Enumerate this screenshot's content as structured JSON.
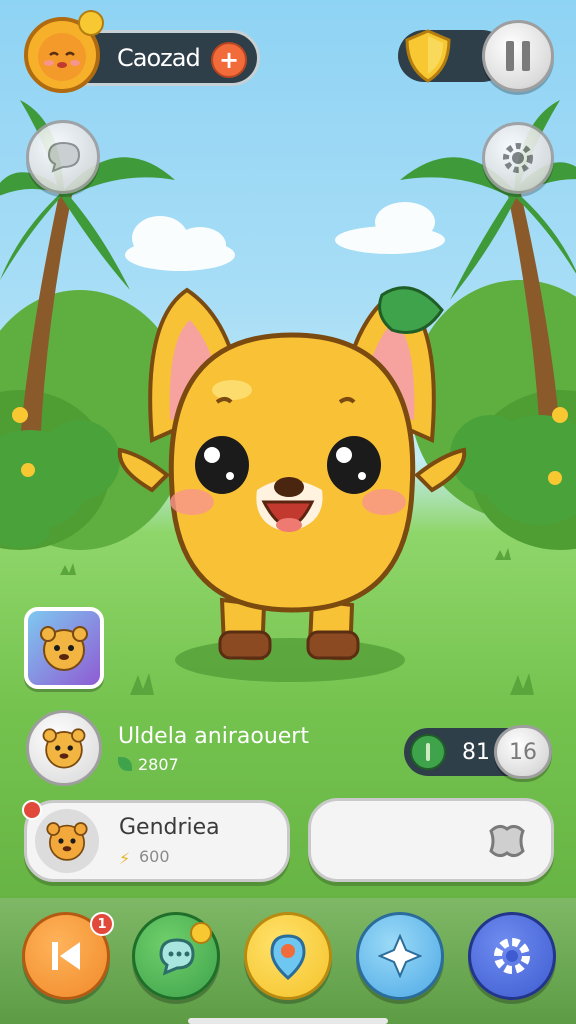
{
  "profile": {
    "name": "Caozad",
    "plus_label": "+"
  },
  "status_bar": {
    "left_value": "81",
    "right_value": "16"
  },
  "pet_info": {
    "title": "Uldela aniraouert",
    "value": "2807"
  },
  "card": {
    "title": "Gendriea",
    "value": "600"
  },
  "nav_badge": {
    "count": "1"
  },
  "colors": {
    "accent_orange": "#f0a23a",
    "pet_yellow": "#f9c236",
    "grass": "#74c24e",
    "sky": "#8fd3f4"
  }
}
